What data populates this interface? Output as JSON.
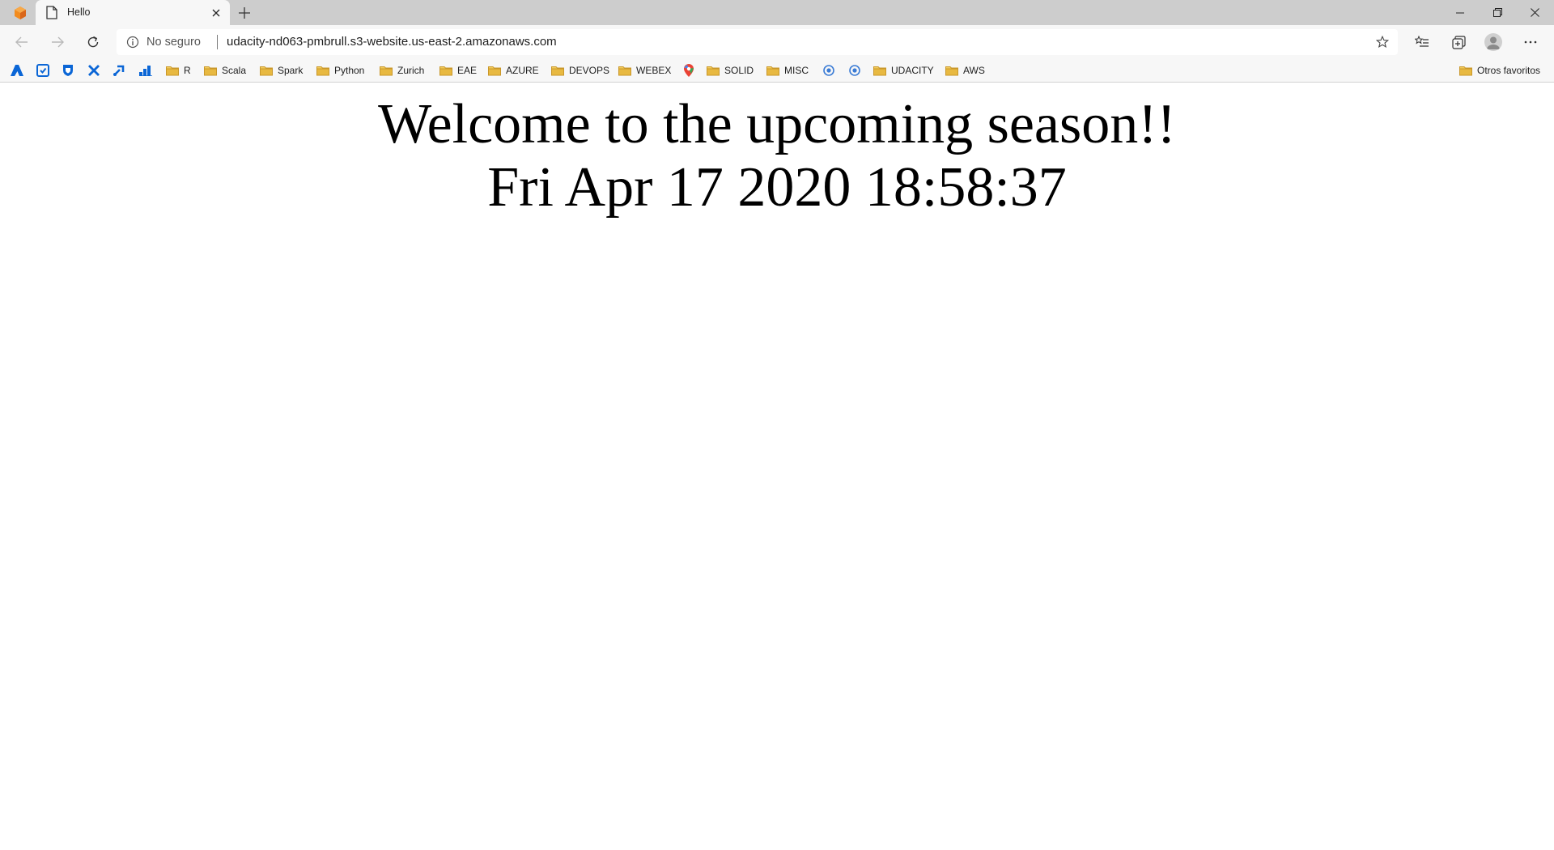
{
  "browser": {
    "tab": {
      "title": "Hello"
    },
    "address": {
      "security_label": "No seguro",
      "url": "udacity-nd063-pmbrull.s3-website.us-east-2.amazonaws.com"
    }
  },
  "favorites": {
    "items": [
      {
        "label": "R"
      },
      {
        "label": "Scala"
      },
      {
        "label": "Spark"
      },
      {
        "label": "Python"
      },
      {
        "label": "Zurich"
      },
      {
        "label": "EAE"
      },
      {
        "label": "AZURE"
      },
      {
        "label": "DEVOPS"
      },
      {
        "label": "WEBEX"
      },
      {
        "label": "SOLID"
      },
      {
        "label": "MISC"
      },
      {
        "label": "UDACITY"
      },
      {
        "label": "AWS"
      }
    ],
    "other": "Otros favoritos"
  },
  "page": {
    "heading": "Welcome to the upcoming season!!",
    "datetime": "Fri Apr 17 2020 18:58:37"
  },
  "colors": {
    "folder": "#e8b941",
    "brand_blue": "#0b66d6",
    "maps_pin": "#ea4335"
  }
}
